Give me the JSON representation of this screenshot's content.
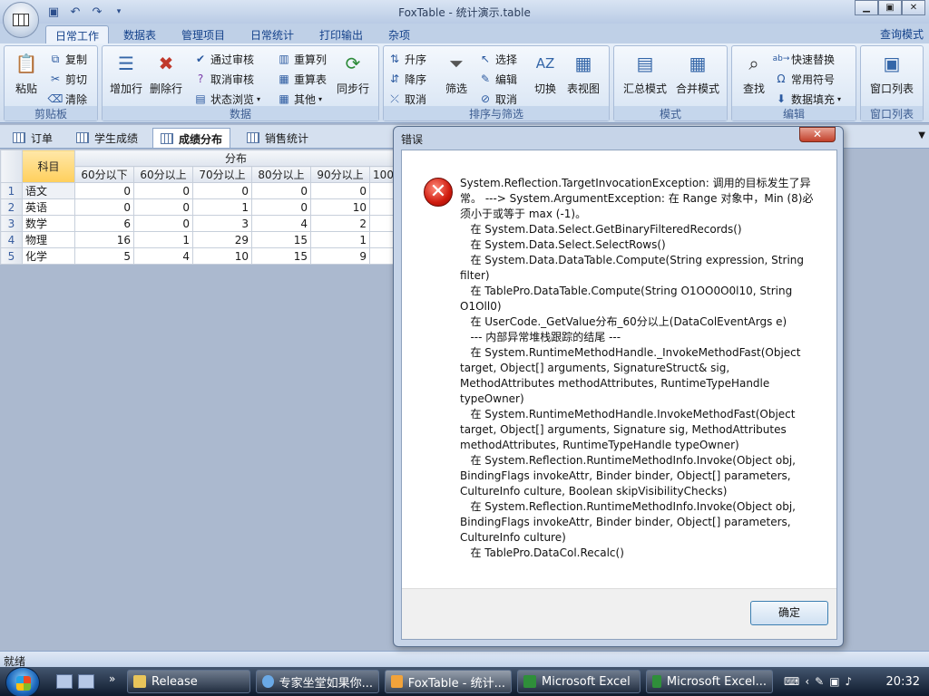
{
  "window": {
    "title": "FoxTable - 统计演示.table"
  },
  "ribbon_tabs": [
    "日常工作",
    "数据表",
    "管理项目",
    "日常统计",
    "打印输出",
    "杂项"
  ],
  "query_mode": "查询模式",
  "groups": {
    "clipboard": {
      "label": "剪贴板",
      "paste": "粘贴",
      "copy": "复制",
      "cut": "剪切",
      "clear": "清除"
    },
    "data": {
      "label": "数据",
      "add_row": "增加行",
      "delete_row": "删除行",
      "approve": "通过审核",
      "unapprove": "取消审核",
      "status_browse": "状态浏览",
      "rearrange_col": "重算列",
      "recalc_table": "重算表",
      "other": "其他",
      "sync_row": "同步行"
    },
    "sort_filter": {
      "label": "排序与筛选",
      "asc": "升序",
      "desc": "降序",
      "cancel_sort": "取消",
      "filter": "筛选",
      "select": "选择",
      "edit": "编辑",
      "cancel_select": "取消",
      "switch": "切换",
      "table_view": "表视图"
    },
    "mode": {
      "label": "模式",
      "summary_mode": "汇总模式",
      "merge_mode": "合并模式"
    },
    "edit": {
      "label": "编辑",
      "find": "查找",
      "quick_replace": "快速替换",
      "common_symbols": "常用符号",
      "data_fill": "数据填充"
    },
    "window_list": {
      "label": "窗口列表",
      "window_list": "窗口列表"
    }
  },
  "doc_tabs": [
    "订单",
    "学生成绩",
    "成绩分布",
    "销售统计"
  ],
  "grid": {
    "group_header": "分布",
    "subject_header": "科目",
    "columns": [
      "60分以下",
      "60分以上",
      "70分以上",
      "80分以上",
      "90分以上",
      "100"
    ],
    "rows": [
      {
        "num": "1",
        "subject": "语文",
        "values": [
          "0",
          "0",
          "0",
          "0",
          "0"
        ]
      },
      {
        "num": "2",
        "subject": "英语",
        "values": [
          "0",
          "0",
          "1",
          "0",
          "10"
        ]
      },
      {
        "num": "3",
        "subject": "数学",
        "values": [
          "6",
          "0",
          "3",
          "4",
          "2"
        ]
      },
      {
        "num": "4",
        "subject": "物理",
        "values": [
          "16",
          "1",
          "29",
          "15",
          "1"
        ]
      },
      {
        "num": "5",
        "subject": "化学",
        "values": [
          "5",
          "4",
          "10",
          "15",
          "9"
        ]
      }
    ]
  },
  "status": "就绪",
  "dialog": {
    "title": "错误",
    "close_label": "✕",
    "ok_label": "确定",
    "message": "System.Reflection.TargetInvocationException: 调用的目标发生了异常。 ---> System.ArgumentException: 在 Range 对象中，Min (8)必须小于或等于 max (-1)。\n   在 System.Data.Select.GetBinaryFilteredRecords()\n   在 System.Data.Select.SelectRows()\n   在 System.Data.DataTable.Compute(String expression, String filter)\n   在 TablePro.DataTable.Compute(String O1OO0O0l10, String O1Oll0)\n   在 UserCode._GetValue分布_60分以上(DataColEventArgs e)\n   --- 内部异常堆栈跟踪的结尾 ---\n   在 System.RuntimeMethodHandle._InvokeMethodFast(Object target, Object[] arguments, SignatureStruct& sig, MethodAttributes methodAttributes, RuntimeTypeHandle typeOwner)\n   在 System.RuntimeMethodHandle.InvokeMethodFast(Object target, Object[] arguments, Signature sig, MethodAttributes methodAttributes, RuntimeTypeHandle typeOwner)\n   在 System.Reflection.RuntimeMethodInfo.Invoke(Object obj, BindingFlags invokeAttr, Binder binder, Object[] parameters, CultureInfo culture, Boolean skipVisibilityChecks)\n   在 System.Reflection.RuntimeMethodInfo.Invoke(Object obj, BindingFlags invokeAttr, Binder binder, Object[] parameters, CultureInfo culture)\n   在 TablePro.DataCol.Recalc()"
  },
  "taskbar": {
    "more": "»",
    "buttons": [
      "Release",
      "专家坐堂如果你...",
      "FoxTable - 统计...",
      "Microsoft Excel",
      "Microsoft Excel..."
    ],
    "clock": "20:32"
  }
}
